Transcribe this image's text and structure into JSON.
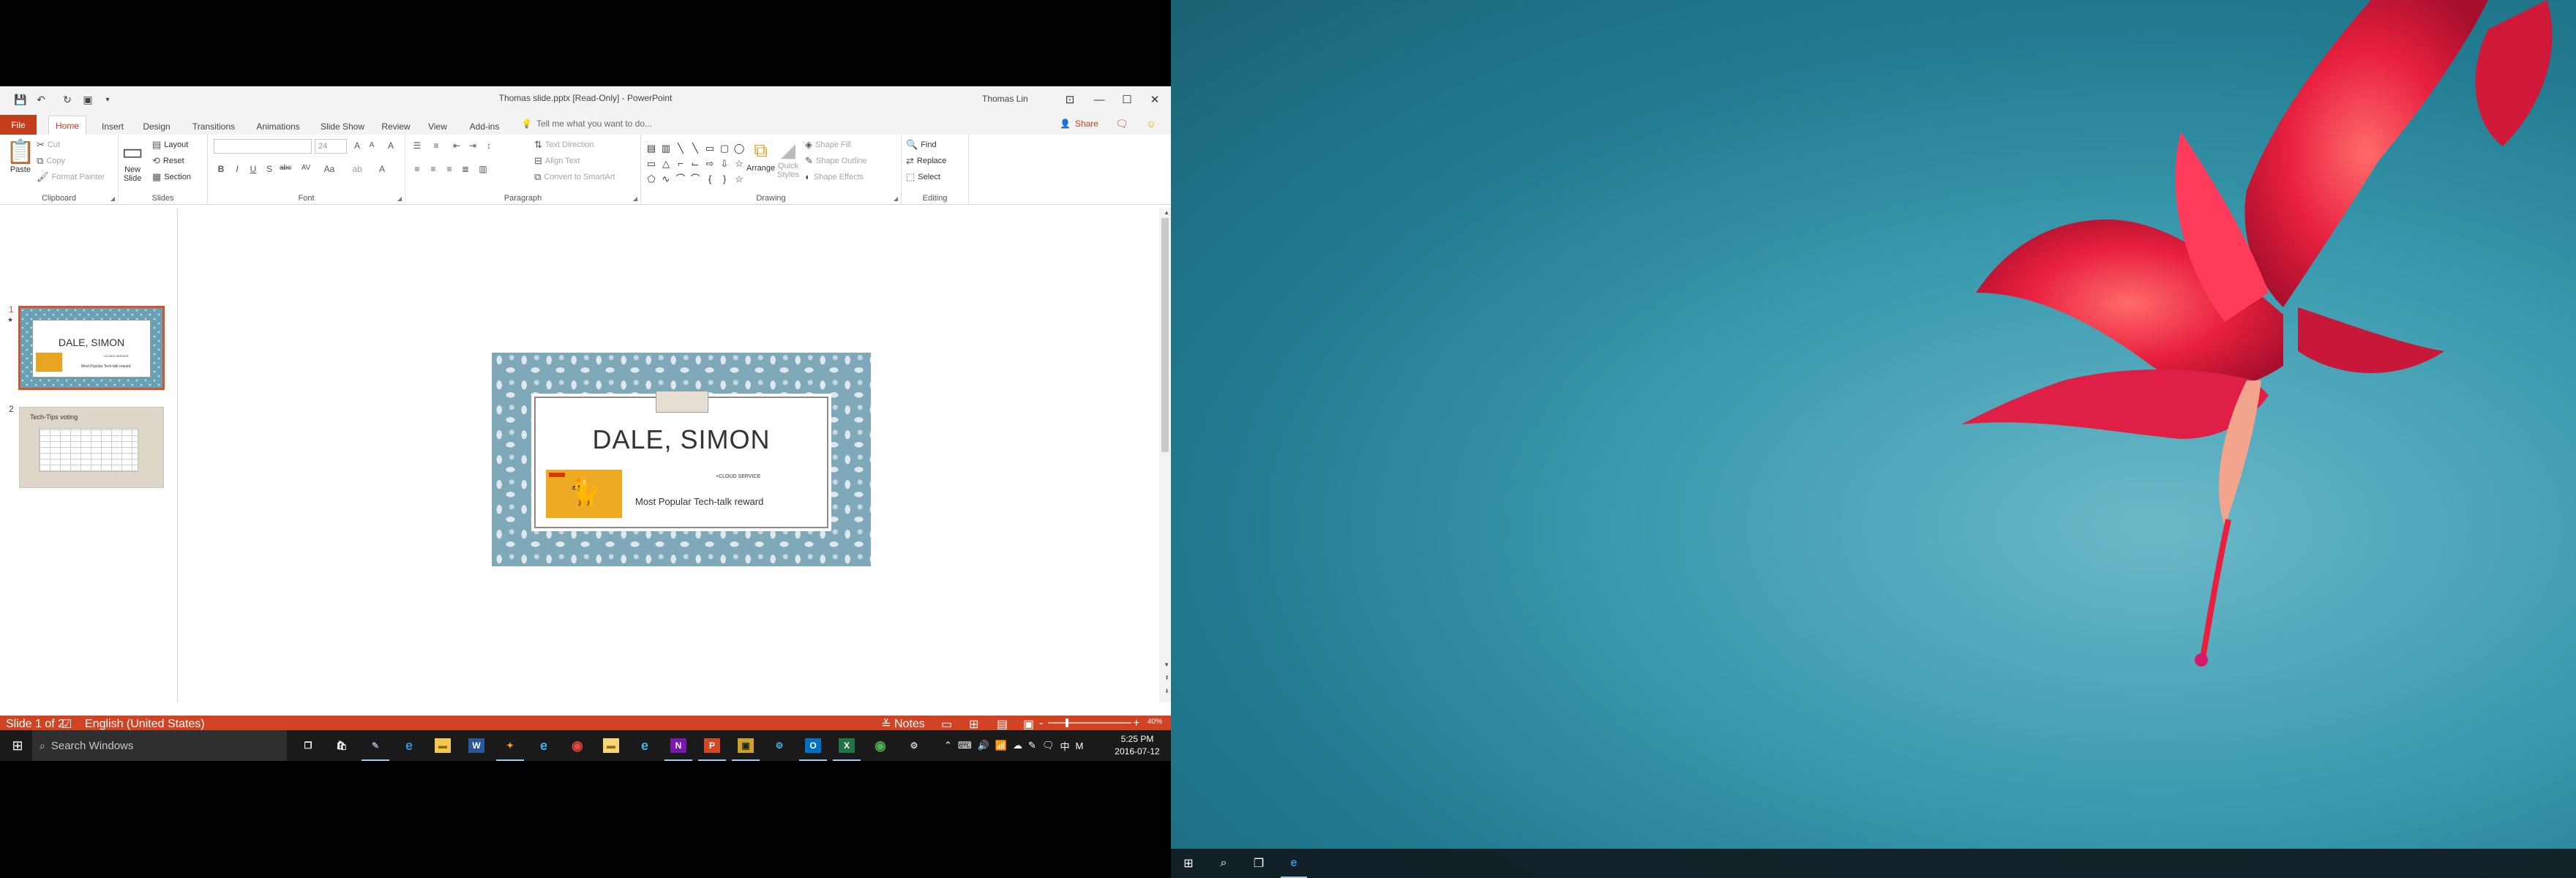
{
  "window": {
    "title": "Thomas slide.pptx [Read-Only] - PowerPoint",
    "user": "Thomas Lin",
    "controls": {
      "minimize": "—",
      "maximize": "☐",
      "close": "✕",
      "ribbon_display": "⊡"
    }
  },
  "quick_access": {
    "save": "💾",
    "undo": "↶",
    "redo": "↻",
    "present": "▣",
    "more": "▾"
  },
  "tabs": {
    "file": "File",
    "items": [
      "Home",
      "Insert",
      "Design",
      "Transitions",
      "Animations",
      "Slide Show",
      "Review",
      "View",
      "Add-ins"
    ],
    "active": "Home",
    "tell_me": "Tell me what you want to do...",
    "share": "Share"
  },
  "ribbon": {
    "clipboard": {
      "label": "Clipboard",
      "paste": "Paste",
      "cut": "Cut",
      "copy": "Copy",
      "format_painter": "Format Painter"
    },
    "slides": {
      "label": "Slides",
      "new_slide": "New",
      "new_slide_2": "Slide",
      "layout": "Layout",
      "reset": "Reset",
      "section": "Section"
    },
    "font": {
      "label": "Font",
      "font_name": "",
      "font_size": "24",
      "bold": "B",
      "italic": "I",
      "underline": "U",
      "shadow": "S",
      "strike": "abc",
      "spacing": "AV",
      "case": "Aa",
      "clear": "A",
      "grow": "A",
      "shrink": "A",
      "color": "A"
    },
    "paragraph": {
      "label": "Paragraph",
      "text_direction": "Text Direction",
      "align_text": "Align Text",
      "convert_smartart": "Convert to SmartArt"
    },
    "drawing": {
      "label": "Drawing",
      "arrange": "Arrange",
      "quick_styles": "Quick",
      "quick_styles_2": "Styles",
      "shape_fill": "Shape Fill",
      "shape_outline": "Shape Outline",
      "shape_effects": "Shape Effects"
    },
    "editing": {
      "label": "Editing",
      "find": "Find",
      "replace": "Replace",
      "select": "Select"
    }
  },
  "thumbnails": [
    {
      "number": "1",
      "star": "★",
      "name": "DALE, SIMON",
      "subtitle": "+CLOUD SERVICE",
      "award": "Most Popular Tech-talk reward"
    },
    {
      "number": "2",
      "title": "Tech-Tips voting"
    }
  ],
  "slide": {
    "name": "DALE, SIMON",
    "subtitle": "+CLOUD SERVICE",
    "award": "Most Popular Tech-talk reward"
  },
  "status": {
    "slide": "Slide 1 of 2",
    "language": "English (United States)",
    "notes": "Notes",
    "zoom": "40%",
    "zoom_minus": "-",
    "zoom_plus": "+"
  },
  "taskbar_left": {
    "search_placeholder": "Search Windows",
    "apps": [
      "task-view",
      "store",
      "pen",
      "edge",
      "file-explorer",
      "word",
      "paint",
      "ie",
      "chrome",
      "folder",
      "ie",
      "onenote",
      "powerpoint",
      "app",
      "sharepoint",
      "outlook",
      "excel",
      "chrome-alt",
      "settings"
    ],
    "time": "5:25 PM",
    "date": "2016-07-12",
    "ime": "M"
  },
  "taskbar_right": {
    "apps": [
      "start",
      "search",
      "task-view",
      "edge"
    ]
  },
  "colors": {
    "accent": "#d04423",
    "file_tab": "#c43e1c",
    "slide_bg": "#7fa9b8",
    "selection": "#d35230",
    "taskbar": "#1a1a1a",
    "wallpaper": "#2a8aa0",
    "flower": "#e8203f"
  }
}
